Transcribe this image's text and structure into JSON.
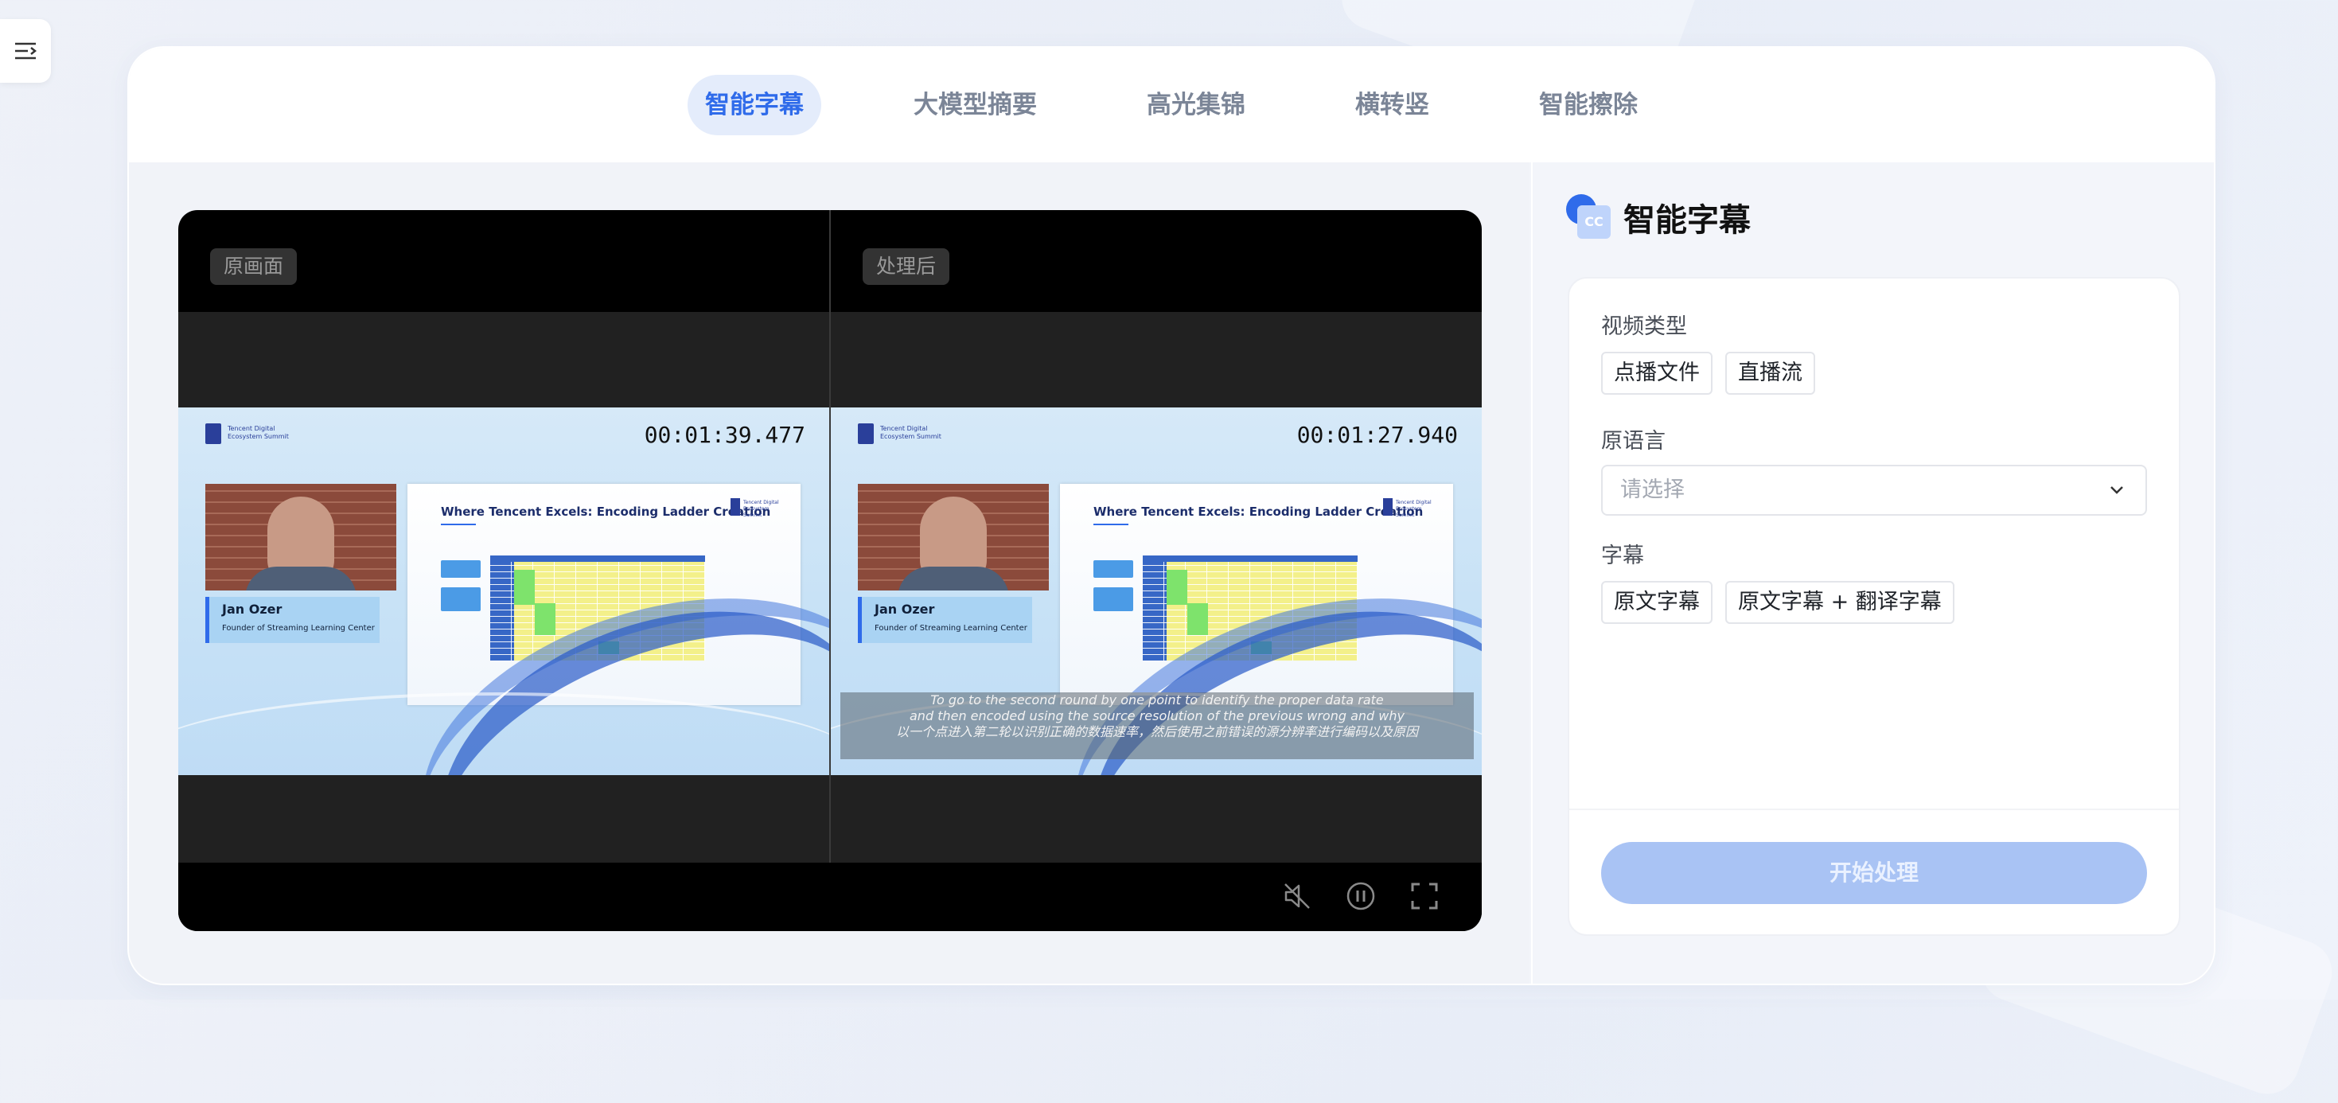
{
  "tabs": [
    "智能字幕",
    "大模型摘要",
    "高光集锦",
    "横转竖",
    "智能擦除"
  ],
  "player": {
    "original_label": "原画面",
    "processed_label": "处理后",
    "original_timecode": "00:01:39.477",
    "processed_timecode": "00:01:27.940",
    "speaker_name": "Jan Ozer",
    "speaker_title": "Founder of Streaming Learning Center",
    "slide_title": "Where Tencent Excels: Encoding Ladder Creation",
    "logo_text": "Tencent Digital Ecosystem Summit",
    "subtitle_lines": [
      "To go to the second round by one point to identify the proper data rate",
      "and then encoded using the source resolution of the previous wrong and why",
      "以一个点进入第二轮以识别正确的数据速率，然后使用之前错误的源分辨率进行编码以及原因"
    ],
    "icons": [
      "mute-icon",
      "pause-icon",
      "fullscreen-icon"
    ]
  },
  "panel": {
    "title": "智能字幕",
    "icon_text": "CC",
    "video_type_label": "视频类型",
    "video_type_options": [
      "点播文件",
      "直播流"
    ],
    "source_lang_label": "原语言",
    "source_lang_placeholder": "请选择",
    "subtitle_label": "字幕",
    "subtitle_options": [
      "原文字幕",
      "原文字幕 + 翻译字幕"
    ],
    "start_button": "开始处理"
  },
  "colors": {
    "accent": "#2f6bea",
    "tab_active_bg": "#e4ecfb",
    "button_disabled": "#a9c3f4"
  }
}
